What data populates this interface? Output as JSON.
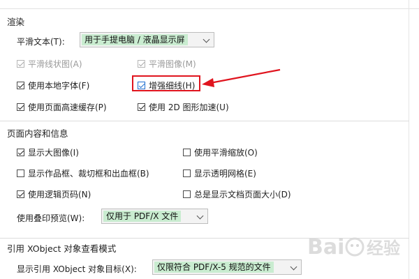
{
  "render": {
    "title": "渲染",
    "smooth_text": {
      "label": "平滑文本(T):",
      "value": "用于手提电脑 / 液晶显示屏"
    },
    "checkboxes": [
      {
        "label": "平滑线状图(A)",
        "checked": true,
        "disabled": true
      },
      {
        "label": "平滑图像(M)",
        "checked": true,
        "disabled": true
      },
      {
        "label": "使用本地字体(F)",
        "checked": true,
        "disabled": false
      },
      {
        "label": "增强细线(H)",
        "checked": true,
        "disabled": false
      },
      {
        "label": "使用页面高速缓存(P)",
        "checked": true,
        "disabled": false
      },
      {
        "label": "使用 2D 图形加速(U)",
        "checked": true,
        "disabled": false
      }
    ]
  },
  "page_content": {
    "title": "页面内容和信息",
    "checkboxes": [
      {
        "label": "显示大图像(I)",
        "checked": true
      },
      {
        "label": "使用平滑缩放(O)",
        "checked": false
      },
      {
        "label": "显示作品框、裁切框和出血框(B)",
        "checked": false
      },
      {
        "label": "显示透明网格(E)",
        "checked": false
      },
      {
        "label": "使用逻辑页码(N)",
        "checked": true
      },
      {
        "label": "总是显示文档页面大小(D)",
        "checked": false
      }
    ],
    "overprint": {
      "label": "使用叠印预览(W):",
      "value": "仅用于 PDF/X 文件"
    }
  },
  "xobject": {
    "title": "引用 XObject 对象查看模式",
    "target": {
      "label": "显示引用 XObject 对象目标(X):",
      "value": "仅限符合 PDF/X-5 规范的文件"
    }
  },
  "colors": {
    "highlight": "#e0141e",
    "dropdown_value_bg": "#c9ecd0"
  },
  "watermark": {
    "text": "Bai 经验"
  }
}
